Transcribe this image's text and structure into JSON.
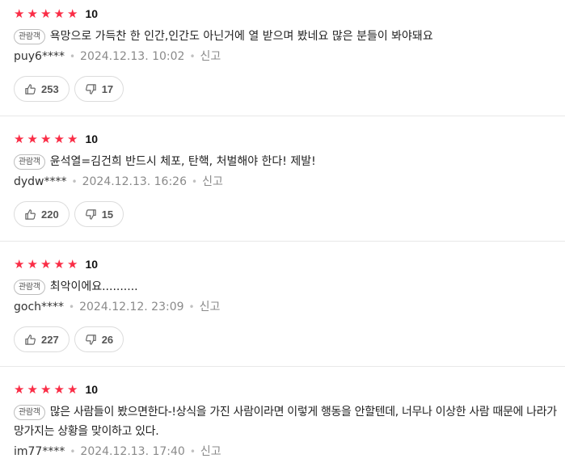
{
  "reviews": [
    {
      "stars": "★★★★★",
      "score": "10",
      "badge": "관람객",
      "text": "욕망으로 가득찬 한 인간,인간도 아닌거에 열 받으며 봤네요 많은 분들이 봐야돼요",
      "user": "puy6****",
      "date": "2024.12.13. 10:02",
      "report": "신고",
      "likes": "253",
      "dislikes": "17"
    },
    {
      "stars": "★★★★★",
      "score": "10",
      "badge": "관람객",
      "text": "윤석열=김건희 반드시 체포, 탄핵, 처벌해야 한다! 제발!",
      "user": "dydw****",
      "date": "2024.12.13. 16:26",
      "report": "신고",
      "likes": "220",
      "dislikes": "15"
    },
    {
      "stars": "★★★★★",
      "score": "10",
      "badge": "관람객",
      "text": "최악이에요..........",
      "user": "goch****",
      "date": "2024.12.12. 23:09",
      "report": "신고",
      "likes": "227",
      "dislikes": "26"
    },
    {
      "stars": "★★★★★",
      "score": "10",
      "badge": "관람객",
      "text": "많은 사람들이 봤으면한다-!상식을 가진 사람이라면 이렇게 행동을 안할텐데, 너무나 이상한 사람 때문에 나라가 망가지는 상황을 맞이하고 있다.",
      "user": "im77****",
      "date": "2024.12.13. 17:40",
      "report": "신고"
    }
  ],
  "icons": {
    "like": "thumbs-up-icon",
    "dislike": "thumbs-down-icon"
  },
  "colors": {
    "star": "#fa2d46",
    "meta": "#8a8a8a",
    "divider": "#e8e8e8"
  }
}
